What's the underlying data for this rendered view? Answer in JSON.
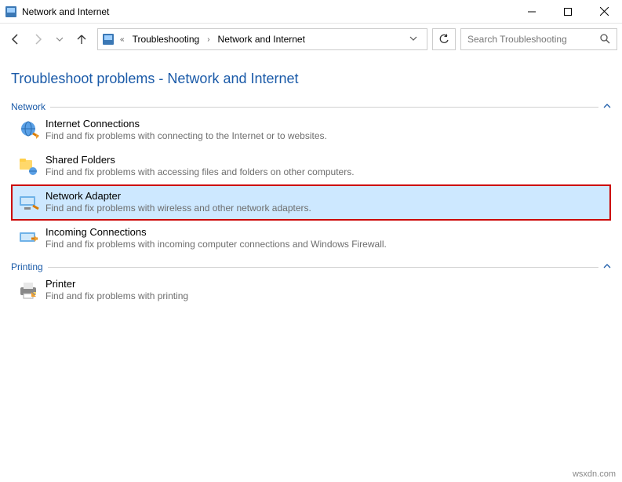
{
  "title_bar": {
    "title": "Network and Internet"
  },
  "breadcrumb": {
    "prefix": "«",
    "crumb1": "Troubleshooting",
    "crumb2": "Network and Internet"
  },
  "search": {
    "placeholder": "Search Troubleshooting"
  },
  "page_title": "Troubleshoot problems - Network and Internet",
  "sections": {
    "network": {
      "label": "Network",
      "items": [
        {
          "title": "Internet Connections",
          "desc": "Find and fix problems with connecting to the Internet or to websites."
        },
        {
          "title": "Shared Folders",
          "desc": "Find and fix problems with accessing files and folders on other computers."
        },
        {
          "title": "Network Adapter",
          "desc": "Find and fix problems with wireless and other network adapters."
        },
        {
          "title": "Incoming Connections",
          "desc": "Find and fix problems with incoming computer connections and Windows Firewall."
        }
      ]
    },
    "printing": {
      "label": "Printing",
      "items": [
        {
          "title": "Printer",
          "desc": "Find and fix problems with printing"
        }
      ]
    }
  },
  "watermark": "wsxdn.com"
}
